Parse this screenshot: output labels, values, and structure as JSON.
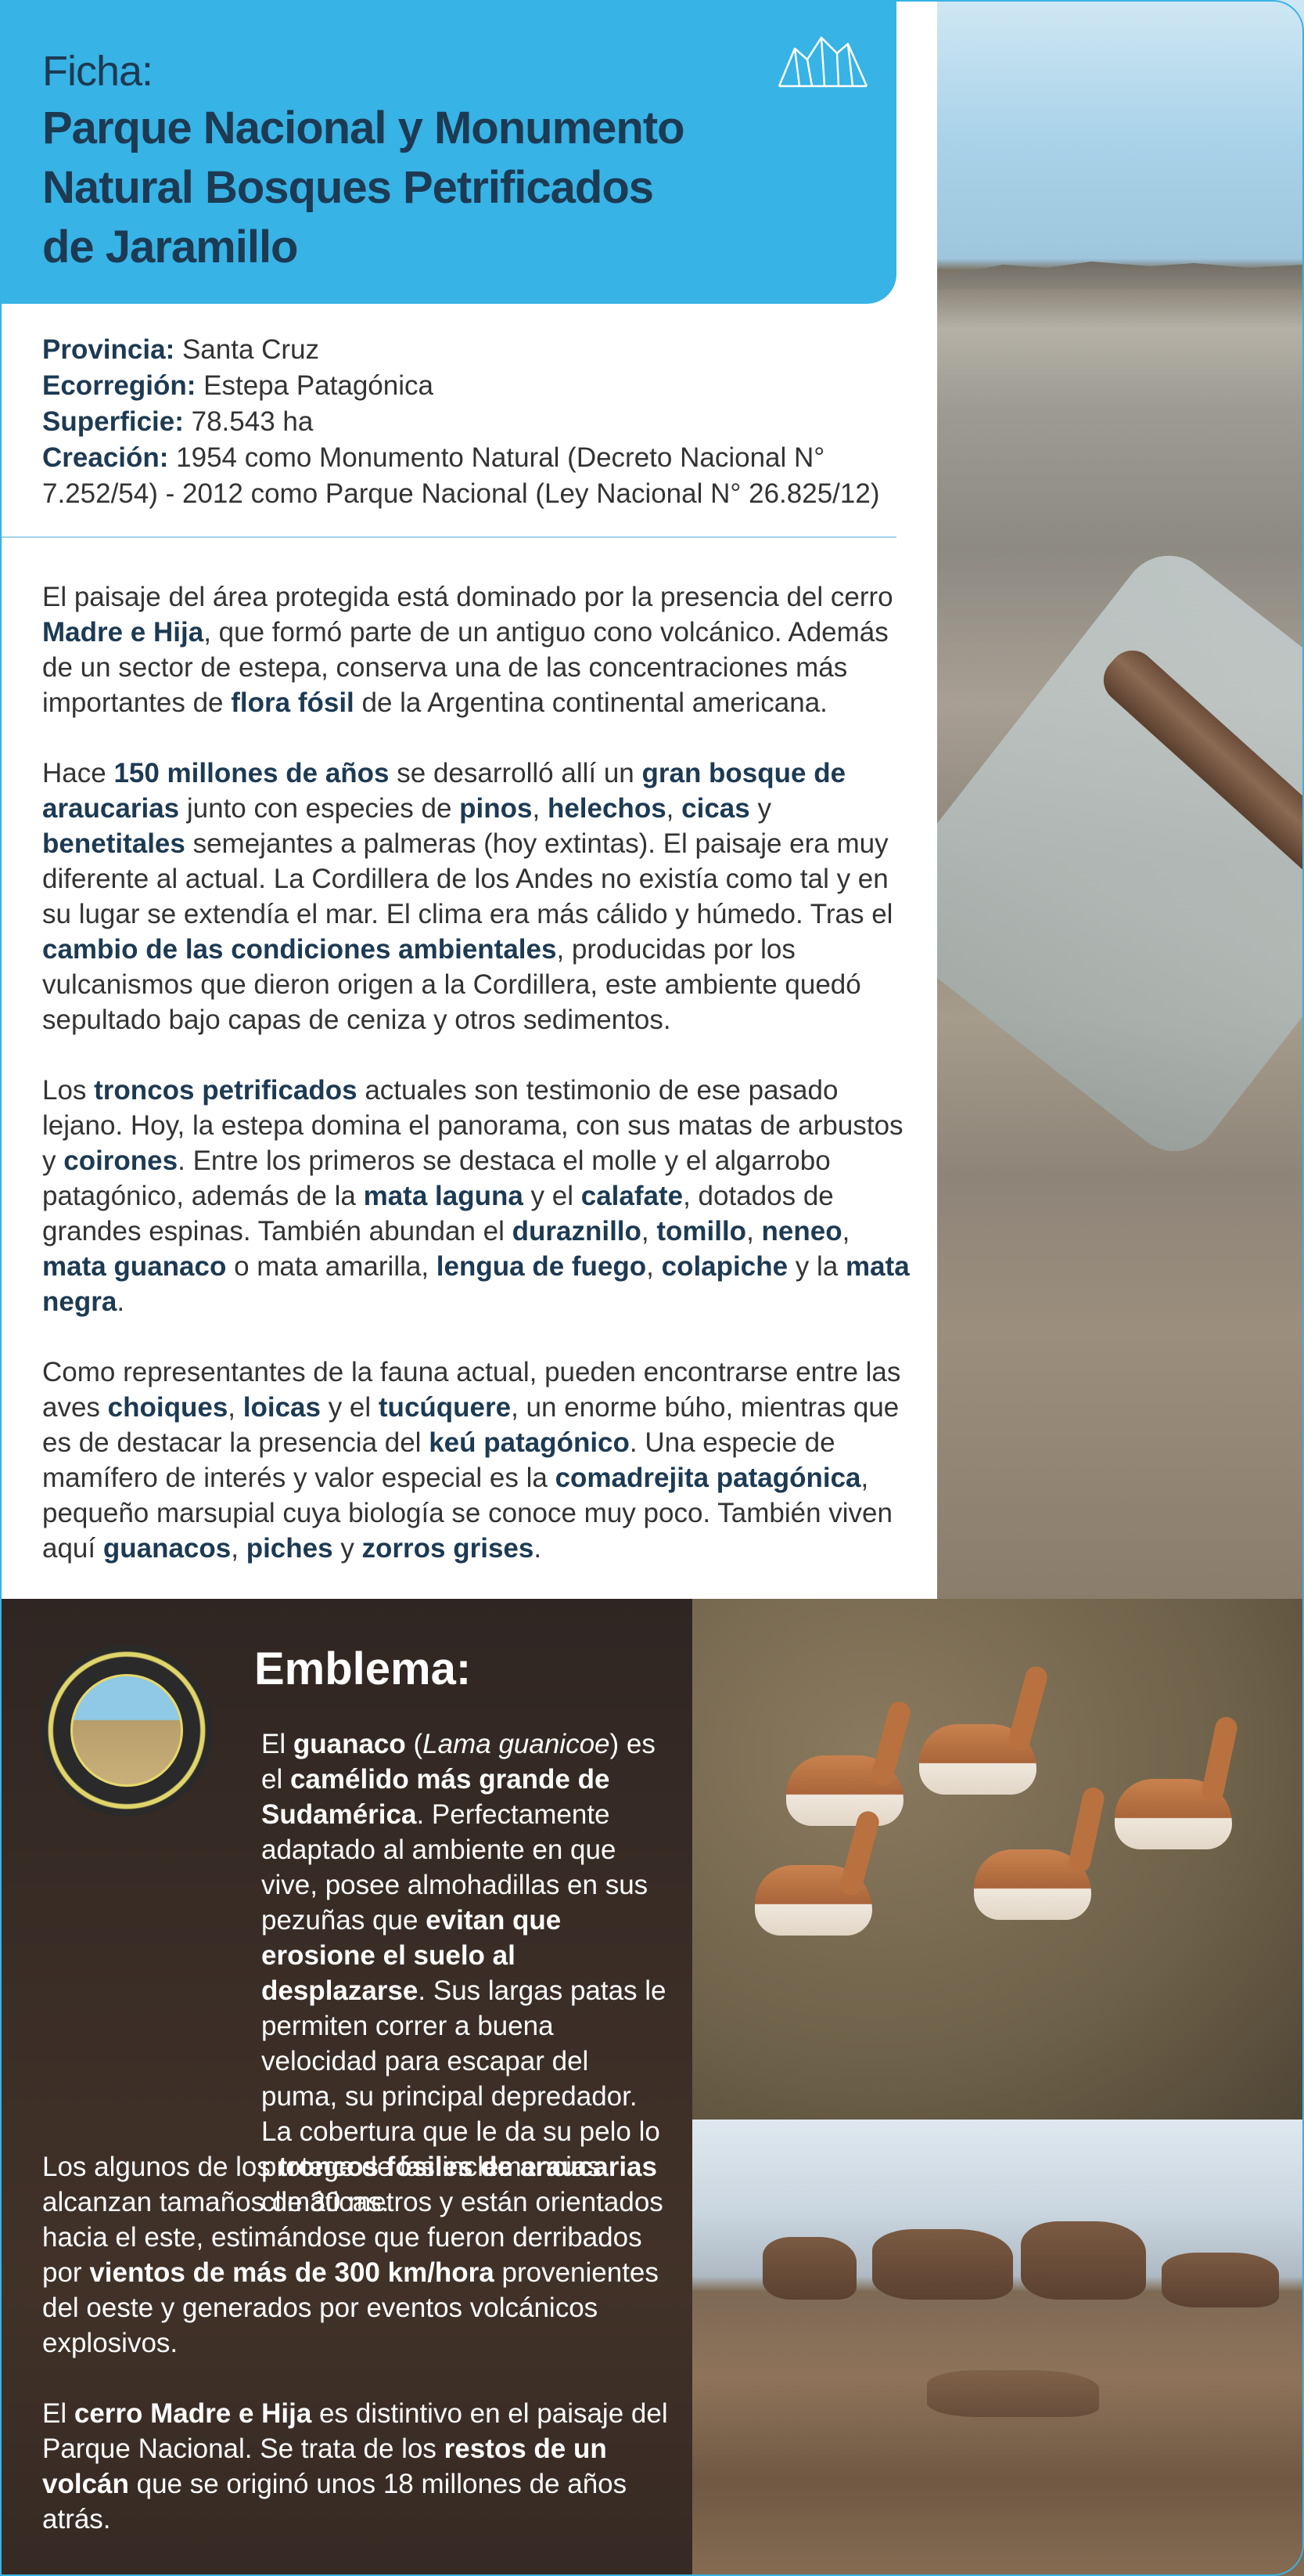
{
  "header": {
    "label": "Ficha:",
    "title": "Parque Nacional y Monumento\nNatural Bosques Petrificados\nde Jaramillo",
    "logo_icon": "mountain-logo-icon"
  },
  "facts": [
    {
      "label": "Provincia:",
      "value": " Santa Cruz"
    },
    {
      "label": "Ecorregión:",
      "value": " Estepa Patagónica"
    },
    {
      "label": "Superficie:",
      "value": " 78.543 ha"
    },
    {
      "label": "Creación:",
      "value": " 1954 como Monumento Natural (Decreto Nacional N° 7.252/54) - 2012 como Parque Nacional (Ley Nacional N° 26.825/12)"
    }
  ],
  "body": {
    "p1": {
      "t1": "El paisaje del área protegida está dominado por la presencia del cerro ",
      "b1": "Madre e Hija",
      "t2": ", que formó parte de un antiguo cono volcánico. Además de un sector de estepa, conserva una de las concentraciones más importantes de ",
      "b2": "flora fósil",
      "t3": " de la Argentina continental americana."
    },
    "p2": {
      "t1": "Hace ",
      "b1": "150 millones de años",
      "t2": " se desarrolló allí un ",
      "b2": "gran bosque de araucarias",
      "t3": " junto con especies de ",
      "b3": "pinos",
      "t4": ", ",
      "b4": "helechos",
      "t5": ", ",
      "b5": "cicas",
      "t6": " y ",
      "b6": "benetitales",
      "t7": " semejantes a palmeras (hoy extintas). El paisaje era muy diferente al actual. La Cordillera de los Andes no existía como tal y en su lugar se extendía el mar. El clima era más cálido y húmedo. Tras el ",
      "b7": "cambio de las condiciones ambientales",
      "t8": ", producidas por los vulcanismos que dieron origen a la Cordillera, este ambiente quedó sepultado bajo capas de ceniza y otros sedimentos."
    },
    "p3": {
      "t1": "Los ",
      "b1": "troncos petrificados",
      "t2": " actuales son testimonio de ese pasado lejano. Hoy, la estepa domina el panorama, con sus matas de arbustos y ",
      "b2": "coirones",
      "t3": ". Entre los primeros se destaca el molle y el algarrobo patagónico, además de la ",
      "b3": "mata laguna",
      "t4": " y el ",
      "b4": "calafate",
      "t5": ", dotados de grandes espinas. También abundan el ",
      "b5": "duraznillo",
      "t6": ", ",
      "b6": "tomillo",
      "t7": ", ",
      "b7": "neneo",
      "t8": ", ",
      "b8": "mata guanaco",
      "t9": " o mata amarilla, ",
      "b9": "lengua de fuego",
      "t10": ", ",
      "b10": "colapiche",
      "t11": " y la ",
      "b11": "mata negra",
      "t12": "."
    },
    "p4": {
      "t1": "Como representantes de la fauna actual, pueden encontrarse entre las aves ",
      "b1": "choiques",
      "t2": ", ",
      "b2": "loicas",
      "t3": " y el ",
      "b3": "tucúquere",
      "t4": ", un enorme búho, mientras que es de destacar la presencia del ",
      "b4": "keú patagónico",
      "t5": ". Una especie de mamífero de interés y valor especial es la ",
      "b5": "comadrejita patagónica",
      "t6": ", pequeño marsupial cuya biología se conoce muy poco. También viven aquí ",
      "b6": "guanacos",
      "t7": ", ",
      "b7": "piches",
      "t8": " y ",
      "b8": "zorros grises",
      "t9": "."
    }
  },
  "emblem": {
    "title": "Emblema:",
    "seal_icon": "park-seal-icon",
    "t1": "El ",
    "b1": "guanaco",
    "t2": " (",
    "i1": "Lama guanicoe",
    "t3": ") es el ",
    "b2": "camélido más grande de Sudamérica",
    "t4": ". Perfectamente adaptado al ambiente en que vive, posee almohadillas en sus pezuñas que ",
    "b3": "evitan que erosione el suelo al desplazarse",
    "t5": ". Sus largas patas le permiten correr a buena velocidad para escapar del puma, su principal depredador. La cobertura que le da su pelo lo protege de las inclemencias climáticas."
  },
  "fossils": {
    "p1": {
      "t1": "Los algunos de los ",
      "b1": "troncos fósiles de araucarias",
      "t2": " alcanzan tamaños de 30 metros y están orientados hacia el este, estimándose que fueron derribados por ",
      "b2": "vientos de más de 300 km/hora",
      "t3": " provenientes del oeste y generados por eventos volcánicos explosivos."
    },
    "p2": {
      "t1": "El ",
      "b1": "cerro Madre e Hija",
      "t2": " es distintivo en el paisaje del Parque Nacional. Se trata de los ",
      "b2": "restos de un volcán",
      "t3": " que se originó unos 18 millones de años atrás."
    }
  },
  "colors": {
    "accent": "#37b3e6",
    "title_text": "#1d3a53"
  }
}
